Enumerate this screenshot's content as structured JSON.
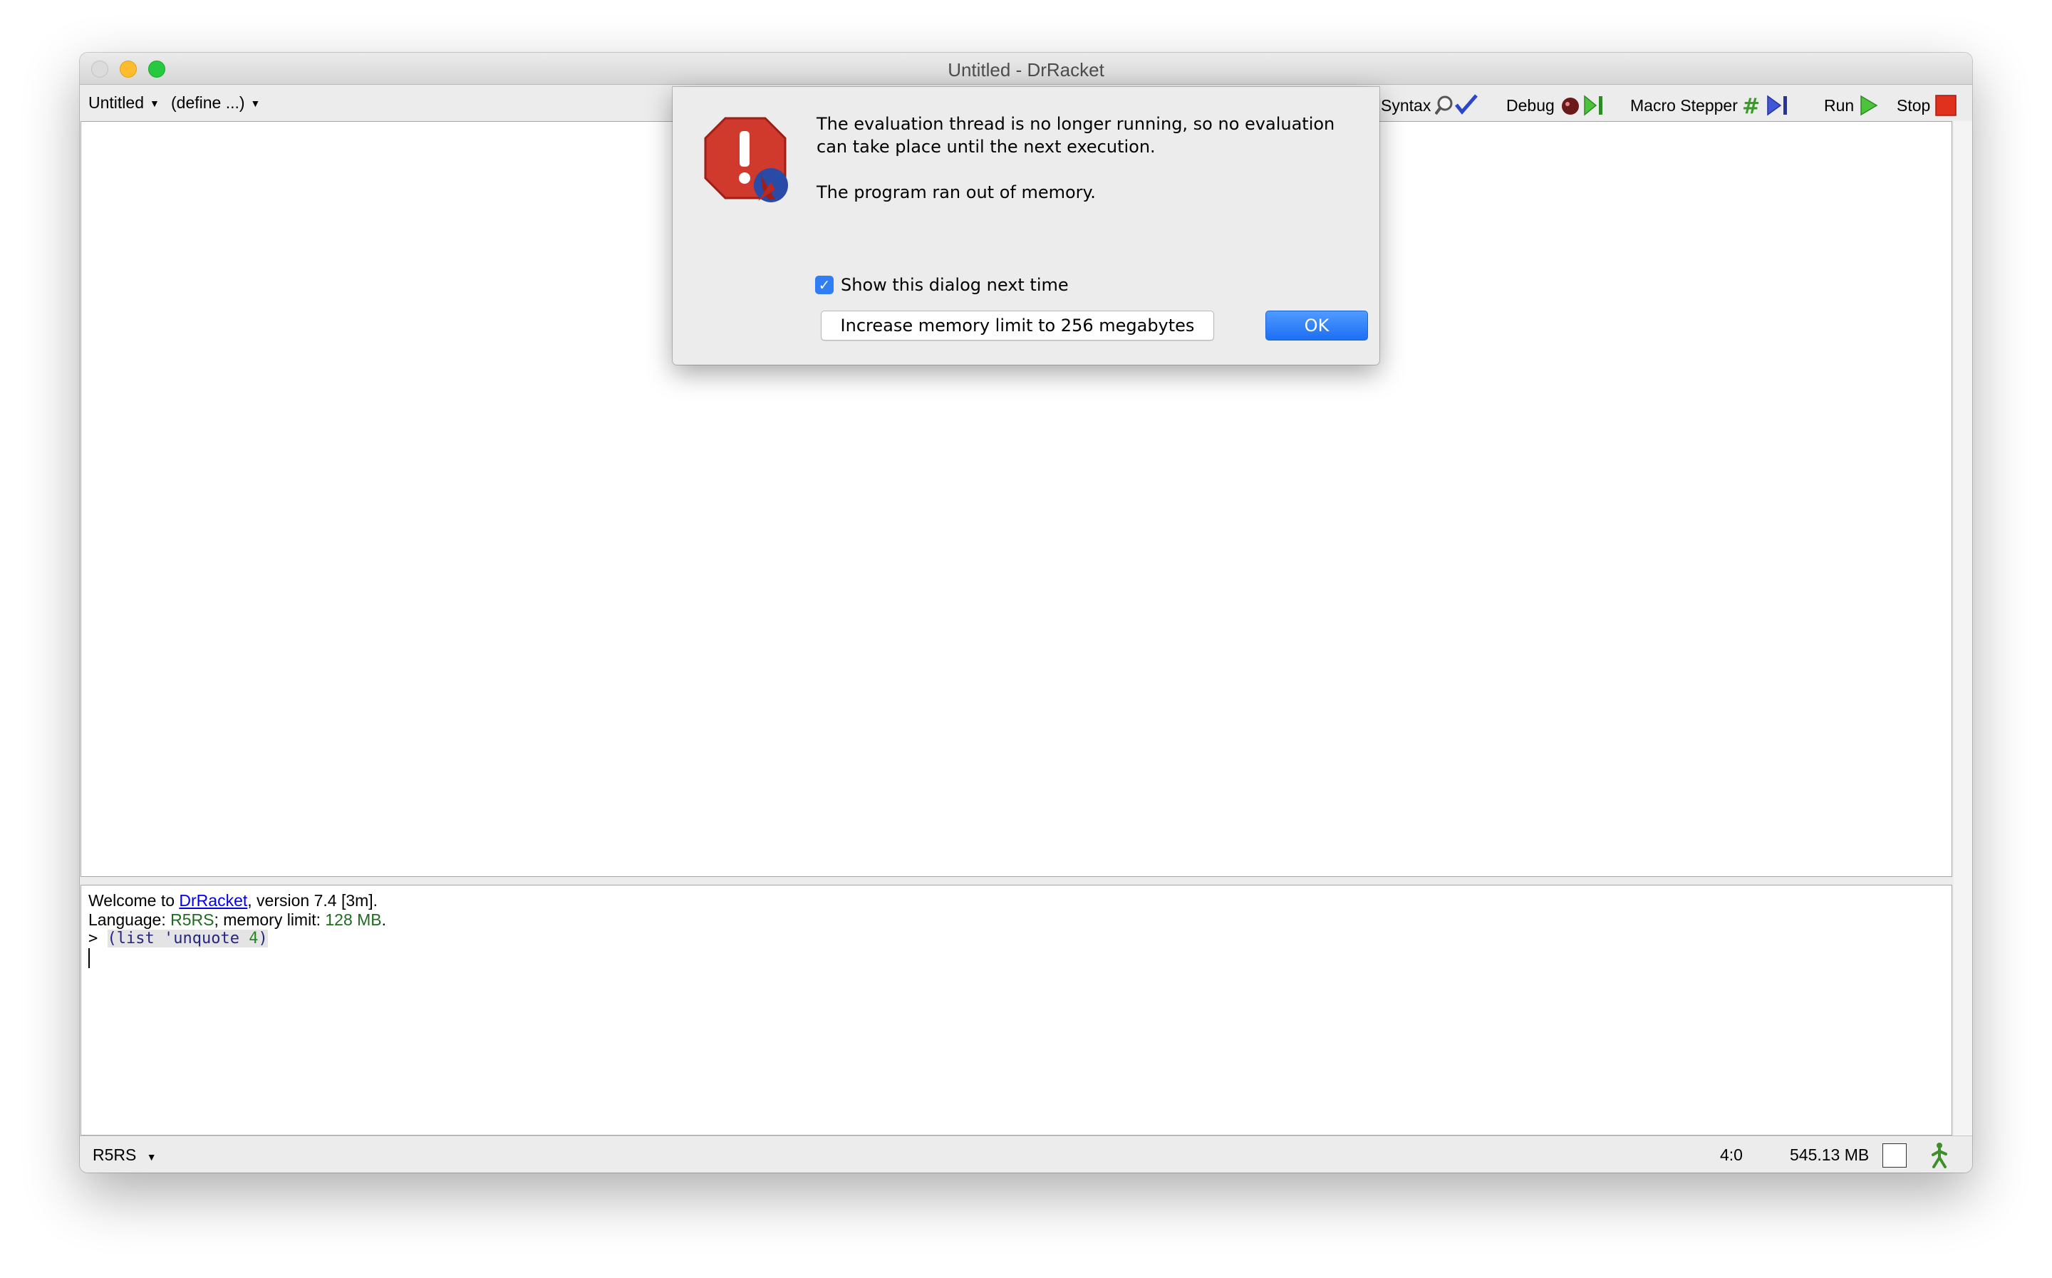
{
  "window": {
    "title": "Untitled - DrRacket"
  },
  "toolbar": {
    "file_menu": "Untitled",
    "define_menu": "(define ...)",
    "check_syntax": "Syntax",
    "debug": "Debug",
    "macro_stepper": "Macro Stepper",
    "run": "Run",
    "stop": "Stop"
  },
  "repl": {
    "welcome_prefix": "Welcome to ",
    "welcome_link": "DrRacket",
    "welcome_suffix": ", version 7.4 [3m].",
    "language_prefix": "Language: ",
    "language_name": "R5RS",
    "memory_prefix": "; memory limit: ",
    "memory_value": "128 MB",
    "memory_suffix": ".",
    "prompt": ">",
    "expr_open": "(list ",
    "expr_quote": "'unquote",
    "expr_space": " ",
    "expr_num": "4",
    "expr_close": ")"
  },
  "status": {
    "language": "R5RS",
    "position": "4:0",
    "memory": "545.13 MB"
  },
  "dialog": {
    "message_1": "The evaluation thread is no longer running, so no evaluation can take place until the next execution.",
    "message_2": "The program ran out of memory.",
    "checkbox_label": "Show this dialog next time",
    "checkbox_checked": true,
    "increase_button": "Increase memory limit to 256 megabytes",
    "ok_button": "OK"
  },
  "colors": {
    "ok_button": "#2f7ef6",
    "link": "#0000ee",
    "green_text": "#1f6b1f",
    "stop_red": "#e0301e",
    "run_green": "#4bc43b"
  }
}
